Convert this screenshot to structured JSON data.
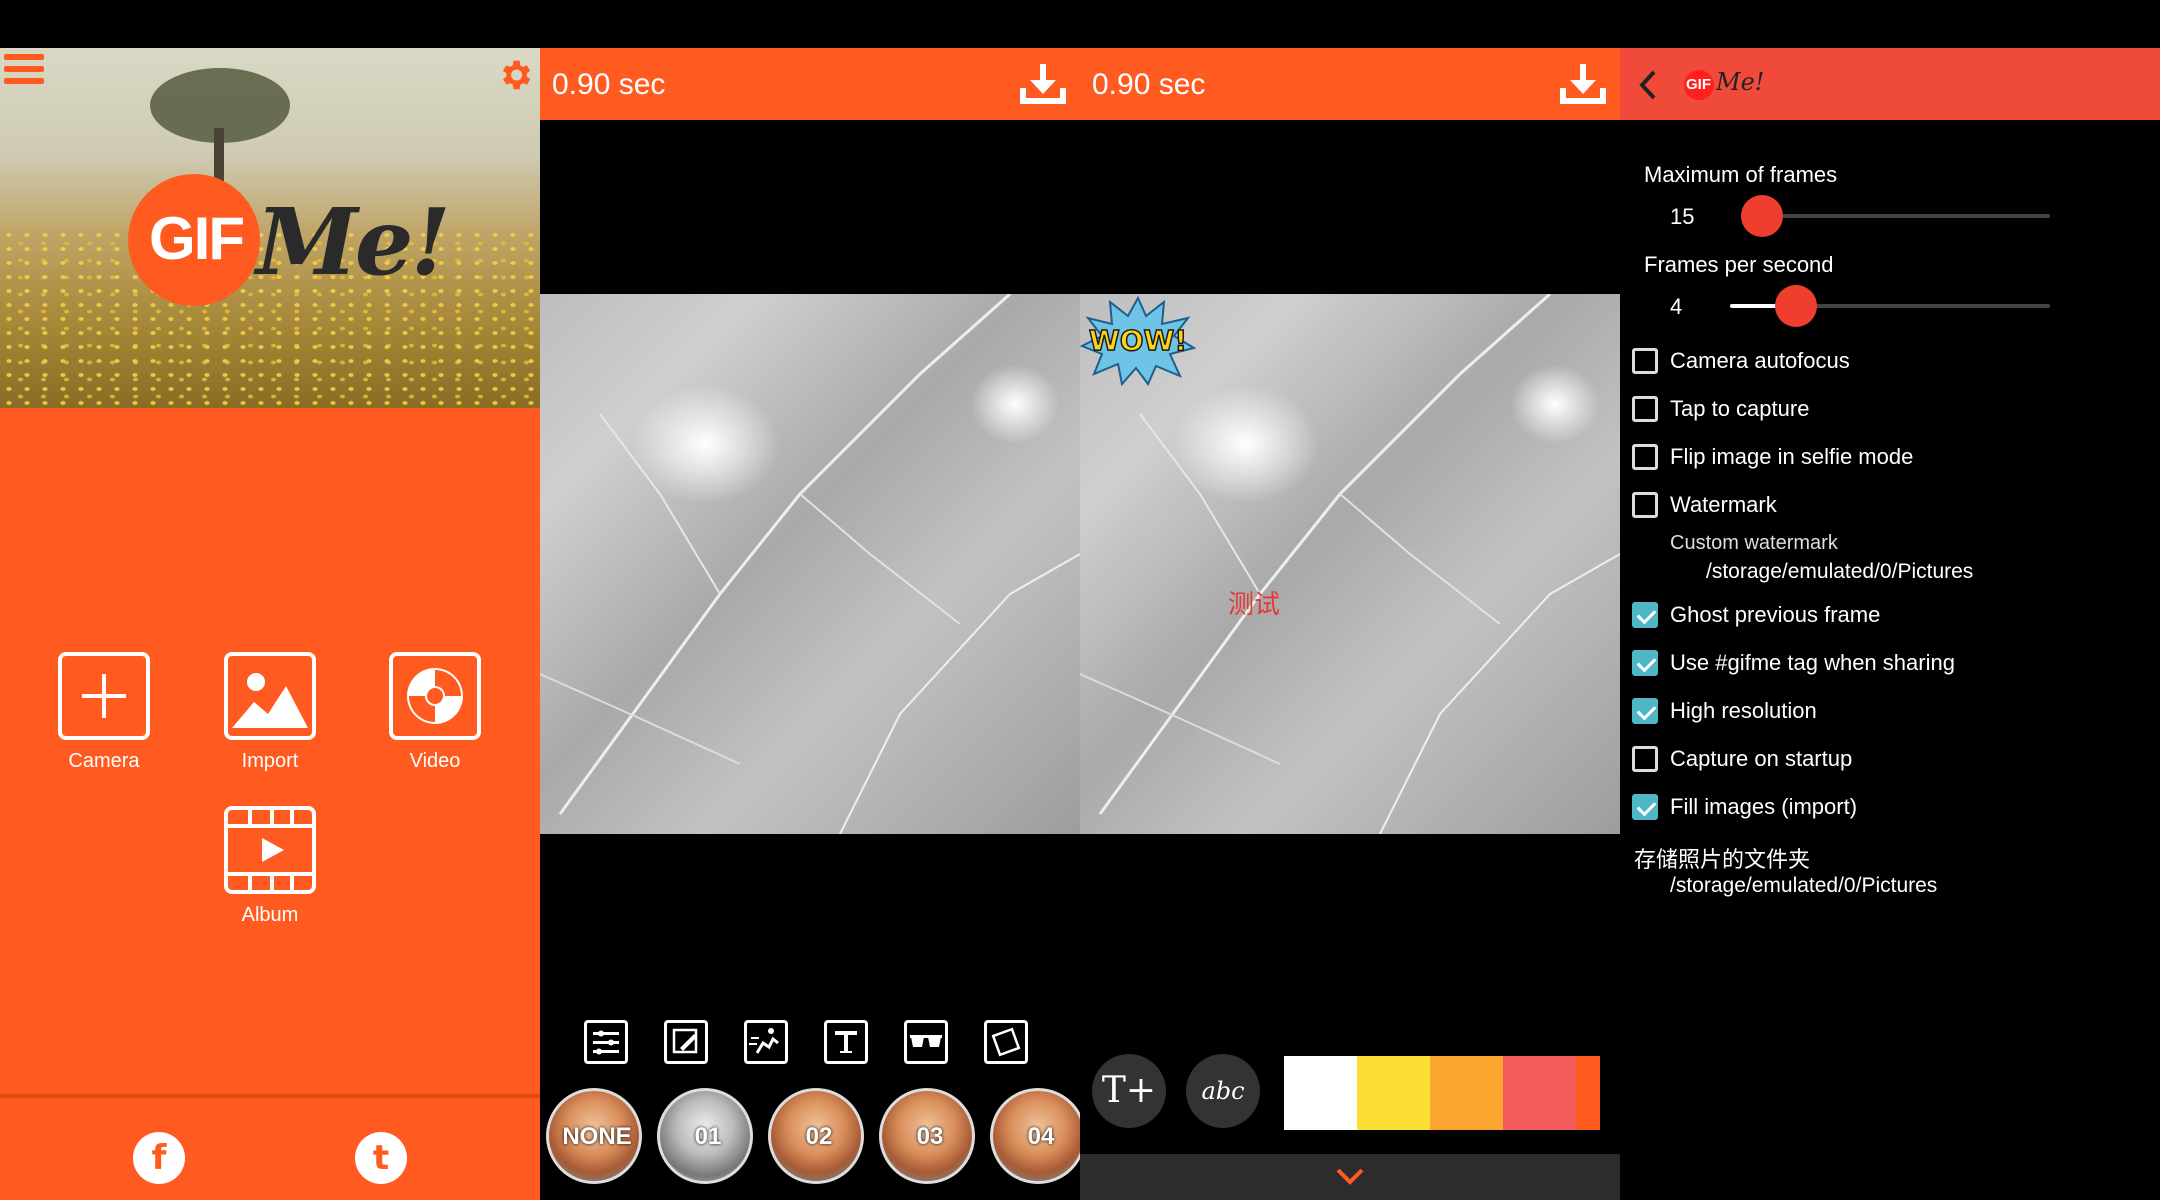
{
  "home": {
    "logo_gif": "GIF",
    "logo_me": "Me!",
    "tiles": [
      {
        "label": "Camera",
        "icon": "plus-icon"
      },
      {
        "label": "Import",
        "icon": "image-icon"
      },
      {
        "label": "Video",
        "icon": "video-reel-icon"
      },
      {
        "label": "Album",
        "icon": "film-play-icon"
      }
    ],
    "social": {
      "facebook_glyph": "f",
      "twitter_glyph": "t"
    },
    "accent": "#ff5a1f"
  },
  "editor": {
    "duration": "0.90 sec",
    "tools": [
      "sliders-icon",
      "edit-frame-icon",
      "run-icon",
      "text-tool-icon",
      "glasses-icon",
      "crop-rotate-icon"
    ],
    "filters": [
      "NONE",
      "01",
      "02",
      "03",
      "04"
    ]
  },
  "text_editor": {
    "duration": "0.90 sec",
    "watermark_text": "测试",
    "sticker_text": "WOW!",
    "add_text_label": "T+",
    "font_label": "abc",
    "palette": [
      "#ffffff",
      "#fbe033",
      "#fba42f",
      "#f35a5a",
      "#ff5a1f"
    ]
  },
  "settings": {
    "logo_gif": "GIF",
    "logo_me": "Me!",
    "max_frames_label": "Maximum of frames",
    "max_frames_value": "15",
    "max_frames_fraction": 0.0,
    "fps_label": "Frames per second",
    "fps_value": "4",
    "fps_fraction": 0.2,
    "checkboxes": [
      {
        "label": "Camera autofocus",
        "checked": false
      },
      {
        "label": "Tap to capture",
        "checked": false
      },
      {
        "label": "Flip image in selfie mode",
        "checked": false
      },
      {
        "label": "Watermark",
        "checked": false
      },
      {
        "label": "Ghost previous frame",
        "checked": true
      },
      {
        "label": "Use #gifme tag when sharing",
        "checked": true
      },
      {
        "label": "High resolution",
        "checked": true
      },
      {
        "label": "Capture on startup",
        "checked": false
      },
      {
        "label": "Fill images (import)",
        "checked": true
      }
    ],
    "custom_watermark_label": "Custom watermark",
    "custom_watermark_path": "/storage/emulated/0/Pictures",
    "folder_label": "存储照片的文件夹",
    "folder_path": "/storage/emulated/0/Pictures"
  }
}
